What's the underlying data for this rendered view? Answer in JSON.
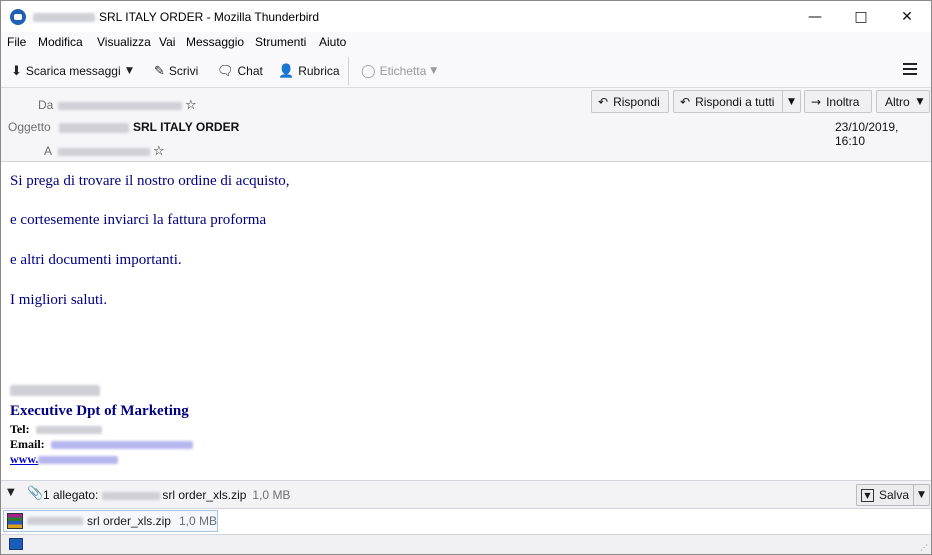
{
  "window": {
    "title": "SRL ITALY ORDER - Mozilla Thunderbird",
    "minimize_icon": "minimize-icon",
    "maximize_icon": "maximize-icon",
    "close_icon": "close-icon"
  },
  "menubar": {
    "items": [
      "File",
      "Modifica",
      "Visualizza",
      "Vai",
      "Messaggio",
      "Strumenti",
      "Aiuto"
    ]
  },
  "toolbar": {
    "get_messages": "Scarica messaggi",
    "write": "Scrivi",
    "chat": "Chat",
    "address_book": "Rubrica",
    "tag": "Etichetta"
  },
  "header": {
    "from_label": "Da",
    "subject_label": "Oggetto",
    "to_label": "A",
    "subject": "SRL ITALY ORDER",
    "date": "23/10/2019, 16:10",
    "reply": "Rispondi",
    "reply_all": "Rispondi a tutti",
    "forward": "Inoltra",
    "more": "Altro"
  },
  "body": {
    "lines": [
      "Si prega di trovare il nostro ordine di acquisto,",
      "e cortesemente inviarci la fattura proforma",
      "e altri documenti importanti.",
      "I migliori saluti."
    ],
    "signature": {
      "title": "Executive Dpt of Marketing",
      "tel_label": "Tel:",
      "email_label": "Email:",
      "web_label": "www."
    }
  },
  "attachments": {
    "summary": "1 allegato:",
    "filename": "srl order_xls.zip",
    "size": "1,0 MB",
    "save": "Salva"
  },
  "colors": {
    "body_text": "#000080",
    "link": "#0000cc"
  }
}
